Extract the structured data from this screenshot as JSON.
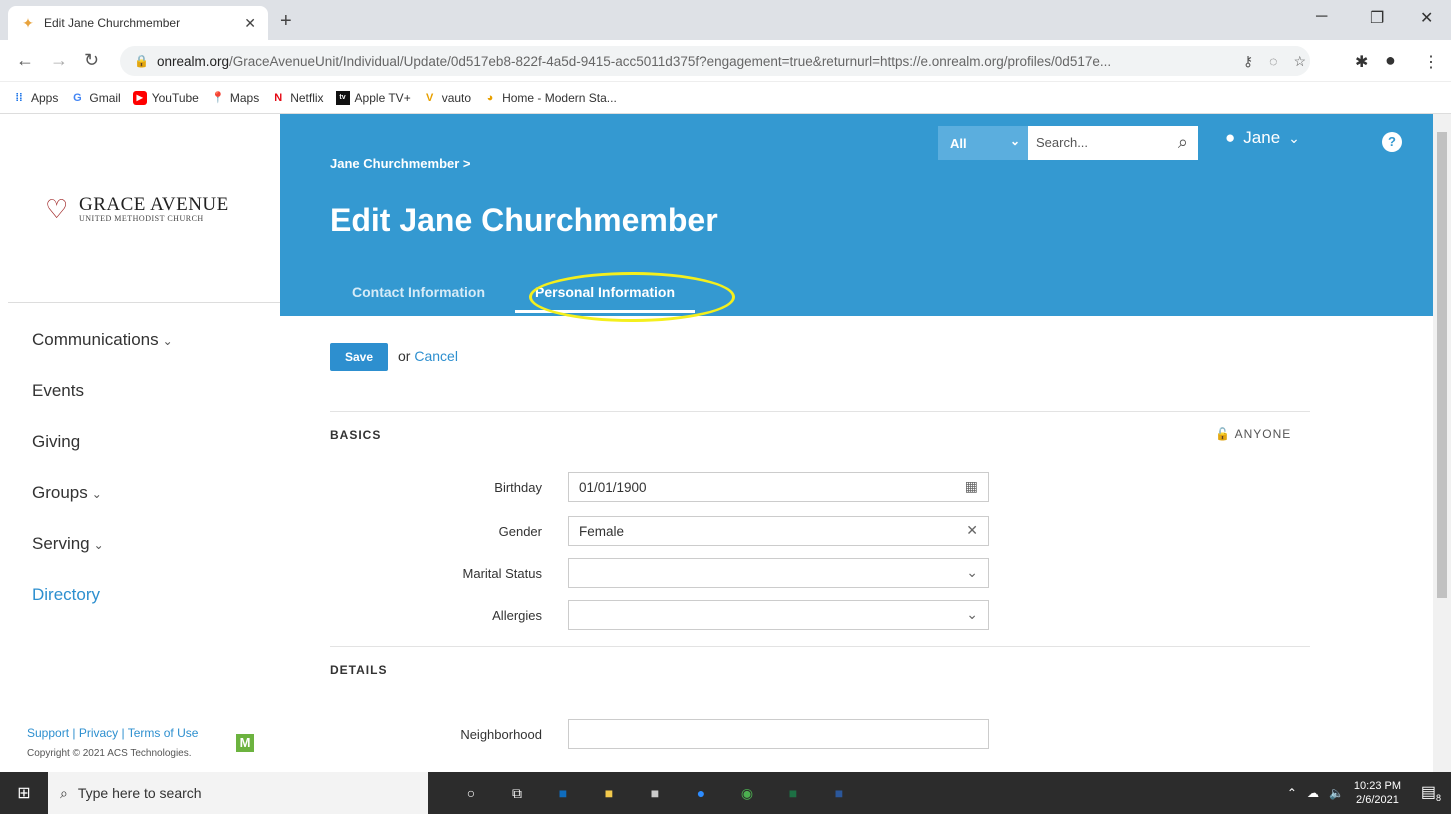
{
  "browser": {
    "tab_title": "Edit Jane Churchmember",
    "url_host": "onrealm.org",
    "url_path": "/GraceAvenueUnit/Individual/Update/0d517eb8-822f-4a5d-9415-acc5011d375f?engagement=true&returnurl=https://e.onrealm.org/profiles/0d517e...",
    "bookmarks": [
      "Apps",
      "Gmail",
      "YouTube",
      "Maps",
      "Netflix",
      "Apple TV+",
      "vauto",
      "Home - Modern Sta..."
    ]
  },
  "logo": {
    "name": "Grace Avenue",
    "sub": "United Methodist Church"
  },
  "sidebar": {
    "items": [
      {
        "label": "Communications"
      },
      {
        "label": "Events"
      },
      {
        "label": "Giving"
      },
      {
        "label": "Groups"
      },
      {
        "label": "Serving"
      },
      {
        "label": "Directory"
      }
    ],
    "footer_support": "Support",
    "footer_privacy": "Privacy",
    "footer_terms": "Terms of Use",
    "copyright": "Copyright © 2021 ACS Technologies.",
    "badge": "M"
  },
  "header": {
    "breadcrumb": "Jane Churchmember >",
    "title": "Edit Jane Churchmember",
    "search_scope": "All",
    "search_placeholder": "Search...",
    "user_name": "Jane",
    "tabs": [
      "Contact Information",
      "Personal Information"
    ]
  },
  "form": {
    "save_label": "Save",
    "or_text": "or",
    "cancel_label": "Cancel",
    "basics_label": "BASICS",
    "privacy_label": "ANYONE",
    "details_label": "DETAILS",
    "fields": [
      {
        "label": "Birthday",
        "value": "01/01/1900"
      },
      {
        "label": "Gender",
        "value": "Female"
      },
      {
        "label": "Marital Status",
        "value": ""
      },
      {
        "label": "Allergies",
        "value": ""
      },
      {
        "label": "Neighborhood",
        "value": ""
      }
    ]
  },
  "taskbar": {
    "search_placeholder": "Type here to search",
    "time": "10:23 PM",
    "date": "2/6/2021",
    "notif_count": "8"
  }
}
